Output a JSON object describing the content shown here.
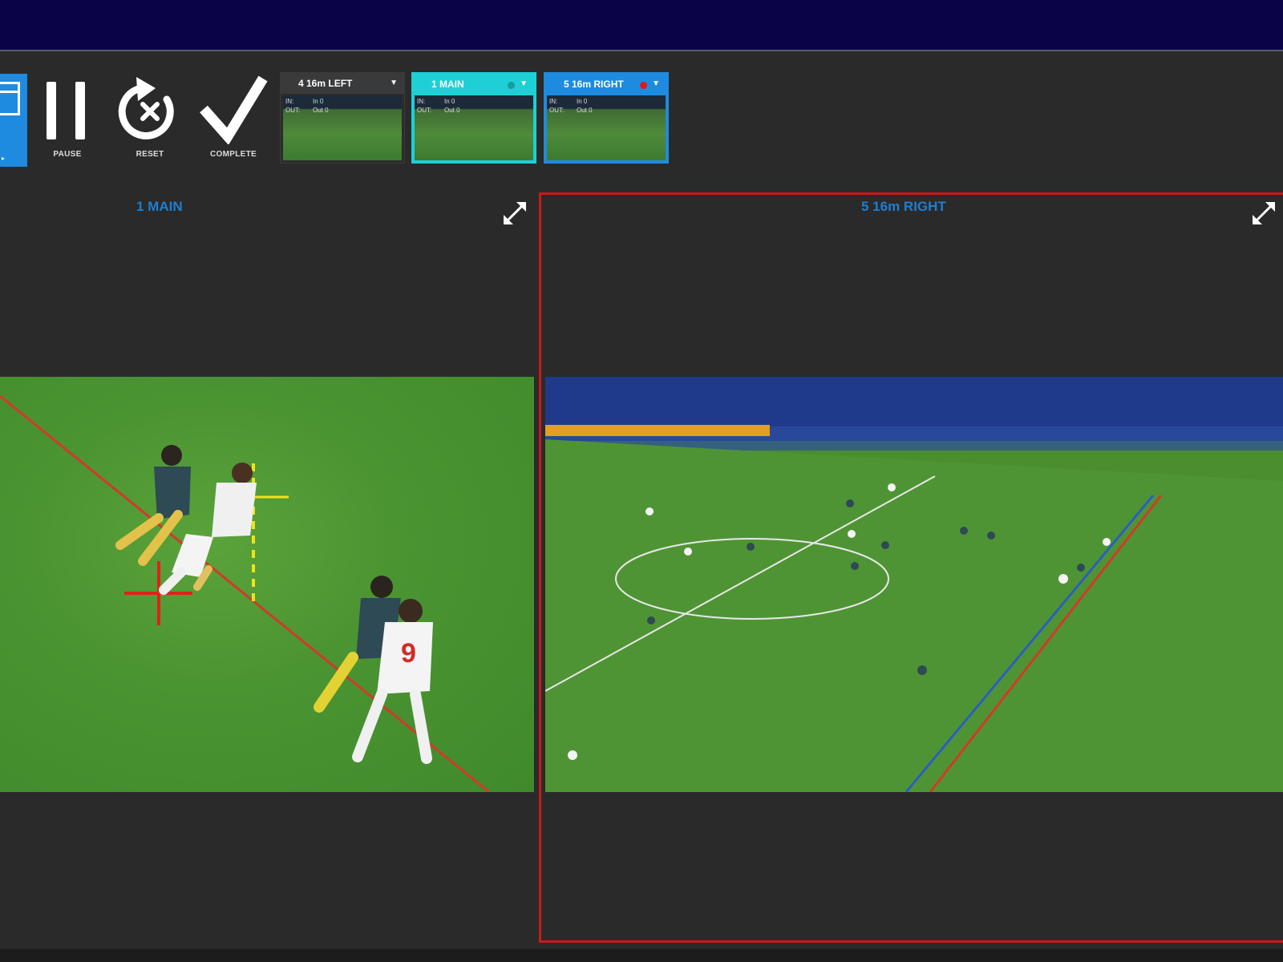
{
  "toolbar": {
    "pause_label": "PAUSE",
    "reset_label": "RESET",
    "complete_label": "COMPLETE"
  },
  "cameras": [
    {
      "label": "4 16m LEFT",
      "in_label": "IN:",
      "in_value": "In 0",
      "out_label": "OUT:",
      "out_value": "Out 0",
      "color": "#3a3a3a"
    },
    {
      "label": "1 MAIN",
      "in_label": "IN:",
      "in_value": "In 0",
      "out_label": "OUT:",
      "out_value": "Out 0",
      "color": "#1ecfd6"
    },
    {
      "label": "5 16m RIGHT",
      "in_label": "IN:",
      "in_value": "In 0",
      "out_label": "OUT:",
      "out_value": "Out 0",
      "color": "#1e8be0",
      "recording": true
    }
  ],
  "panels": {
    "left_title": "1 MAIN",
    "right_title": "5 16m RIGHT"
  },
  "colors": {
    "topbar": "#0a0347",
    "accent_blue": "#1e8be0",
    "accent_cyan": "#1ecfd6",
    "selection_red": "#c61a1a",
    "offside_red_line": "#d23a2a",
    "offside_blue_line": "#2a5fc0",
    "marker_yellow": "#f2e21a"
  }
}
